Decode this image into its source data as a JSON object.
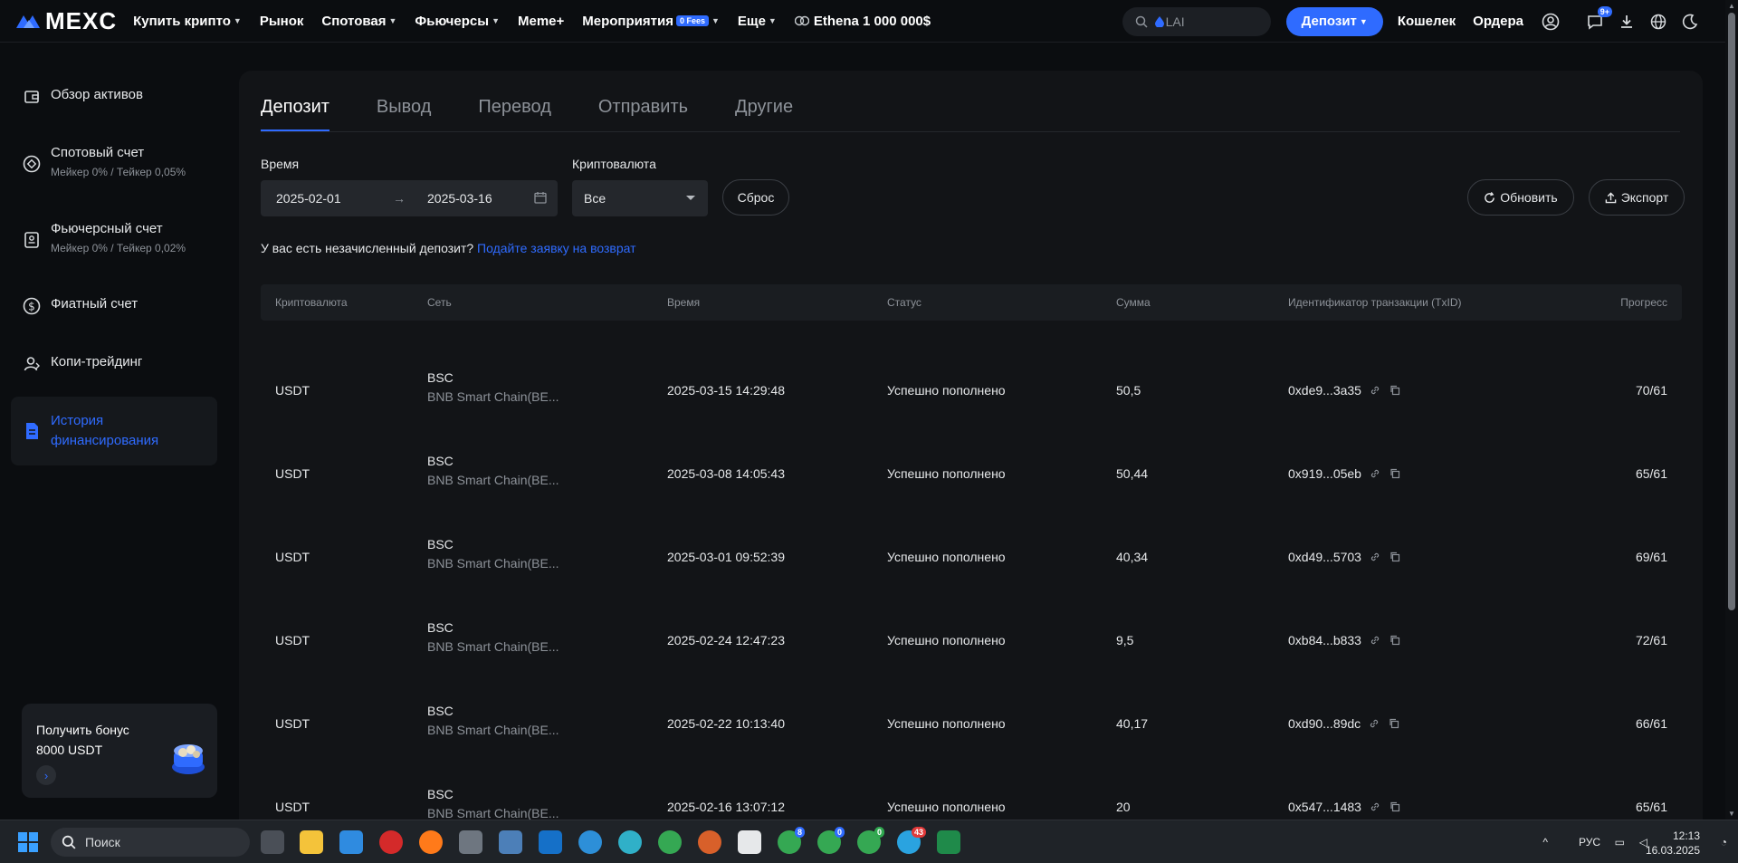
{
  "nav": {
    "logo": "MEXC",
    "items": [
      {
        "label": "Купить крипто",
        "caret": true
      },
      {
        "label": "Рынок",
        "caret": false
      },
      {
        "label": "Спотовая",
        "caret": true
      },
      {
        "label": "Фьючерсы",
        "caret": true
      },
      {
        "label": "Meme+",
        "caret": false
      },
      {
        "label": "Мероприятия",
        "caret": true,
        "badge": "0 Fees"
      },
      {
        "label": "Еще",
        "caret": true
      }
    ],
    "promo": "Ethena 1 000 000$",
    "search_value": "LAI",
    "deposit_button": "Депозит",
    "wallet": "Кошелек",
    "orders": "Ордера",
    "messages_badge": "9+",
    "icons": [
      "user-icon",
      "messages-icon",
      "download-icon",
      "globe-icon",
      "theme-moon-icon"
    ]
  },
  "sidebar": {
    "items": [
      {
        "title": "Обзор активов",
        "sub": "",
        "icon": "wallet-icon"
      },
      {
        "title": "Спотовый счет",
        "sub": "Мейкер 0% / Тейкер 0,05%",
        "icon": "spot-icon"
      },
      {
        "title": "Фьючерсный счет",
        "sub": "Мейкер 0% / Тейкер 0,02%",
        "icon": "futures-icon"
      },
      {
        "title": "Фиатный счет",
        "sub": "",
        "icon": "fiat-dollar-icon"
      },
      {
        "title": "Копи-трейдинг",
        "sub": "",
        "icon": "copy-trading-icon"
      },
      {
        "title": "История финансирования",
        "sub": "",
        "icon": "document-icon",
        "active": true
      }
    ],
    "promo": {
      "line1": "Получить бонус",
      "line2": "8000 USDT"
    }
  },
  "tabs": [
    {
      "label": "Депозит",
      "active": true
    },
    {
      "label": "Вывод"
    },
    {
      "label": "Перевод"
    },
    {
      "label": "Отправить"
    },
    {
      "label": "Другие"
    }
  ],
  "filters": {
    "time_label": "Время",
    "date_from": "2025-02-01",
    "date_to": "2025-03-16",
    "crypto_label": "Криптовалюта",
    "crypto_value": "Все",
    "reset": "Сброс",
    "refresh": "Обновить",
    "export": "Экспорт"
  },
  "notice": {
    "text": "У вас есть незачисленный депозит?",
    "link": "Подайте заявку на возврат"
  },
  "table": {
    "headers": [
      "Криптовалюта",
      "Сеть",
      "Время",
      "Статус",
      "Сумма",
      "Идентификатор транзакции (TxID)",
      "Прогресс"
    ],
    "rows": [
      {
        "crypto": "USDT",
        "net": "BSC",
        "net_full": "BNB Smart Chain(BE...",
        "time": "2025-03-15 14:29:48",
        "status": "Успешно пополнено",
        "amount": "50,5",
        "txid": "0xde9...3a35",
        "progress": "70/61"
      },
      {
        "crypto": "USDT",
        "net": "BSC",
        "net_full": "BNB Smart Chain(BE...",
        "time": "2025-03-08 14:05:43",
        "status": "Успешно пополнено",
        "amount": "50,44",
        "txid": "0x919...05eb",
        "progress": "65/61"
      },
      {
        "crypto": "USDT",
        "net": "BSC",
        "net_full": "BNB Smart Chain(BE...",
        "time": "2025-03-01 09:52:39",
        "status": "Успешно пополнено",
        "amount": "40,34",
        "txid": "0xd49...5703",
        "progress": "69/61"
      },
      {
        "crypto": "USDT",
        "net": "BSC",
        "net_full": "BNB Smart Chain(BE...",
        "time": "2025-02-24 12:47:23",
        "status": "Успешно пополнено",
        "amount": "9,5",
        "txid": "0xb84...b833",
        "progress": "72/61"
      },
      {
        "crypto": "USDT",
        "net": "BSC",
        "net_full": "BNB Smart Chain(BE...",
        "time": "2025-02-22 10:13:40",
        "status": "Успешно пополнено",
        "amount": "40,17",
        "txid": "0xd90...89dc",
        "progress": "66/61"
      },
      {
        "crypto": "USDT",
        "net": "BSC",
        "net_full": "BNB Smart Chain(BE...",
        "time": "2025-02-16 13:07:12",
        "status": "Успешно пополнено",
        "amount": "20",
        "txid": "0x547...1483",
        "progress": "65/61"
      }
    ]
  },
  "taskbar": {
    "search": "Поиск",
    "lang": "РУС",
    "time": "12:13",
    "date": "16.03.2025",
    "badges": {
      "chrome1": "8",
      "chrome2": "0",
      "chrome3": "0",
      "telegram": "43"
    }
  },
  "colors": {
    "accent": "#2f6bff",
    "bg": "#0b0d10",
    "panel": "#121417"
  }
}
